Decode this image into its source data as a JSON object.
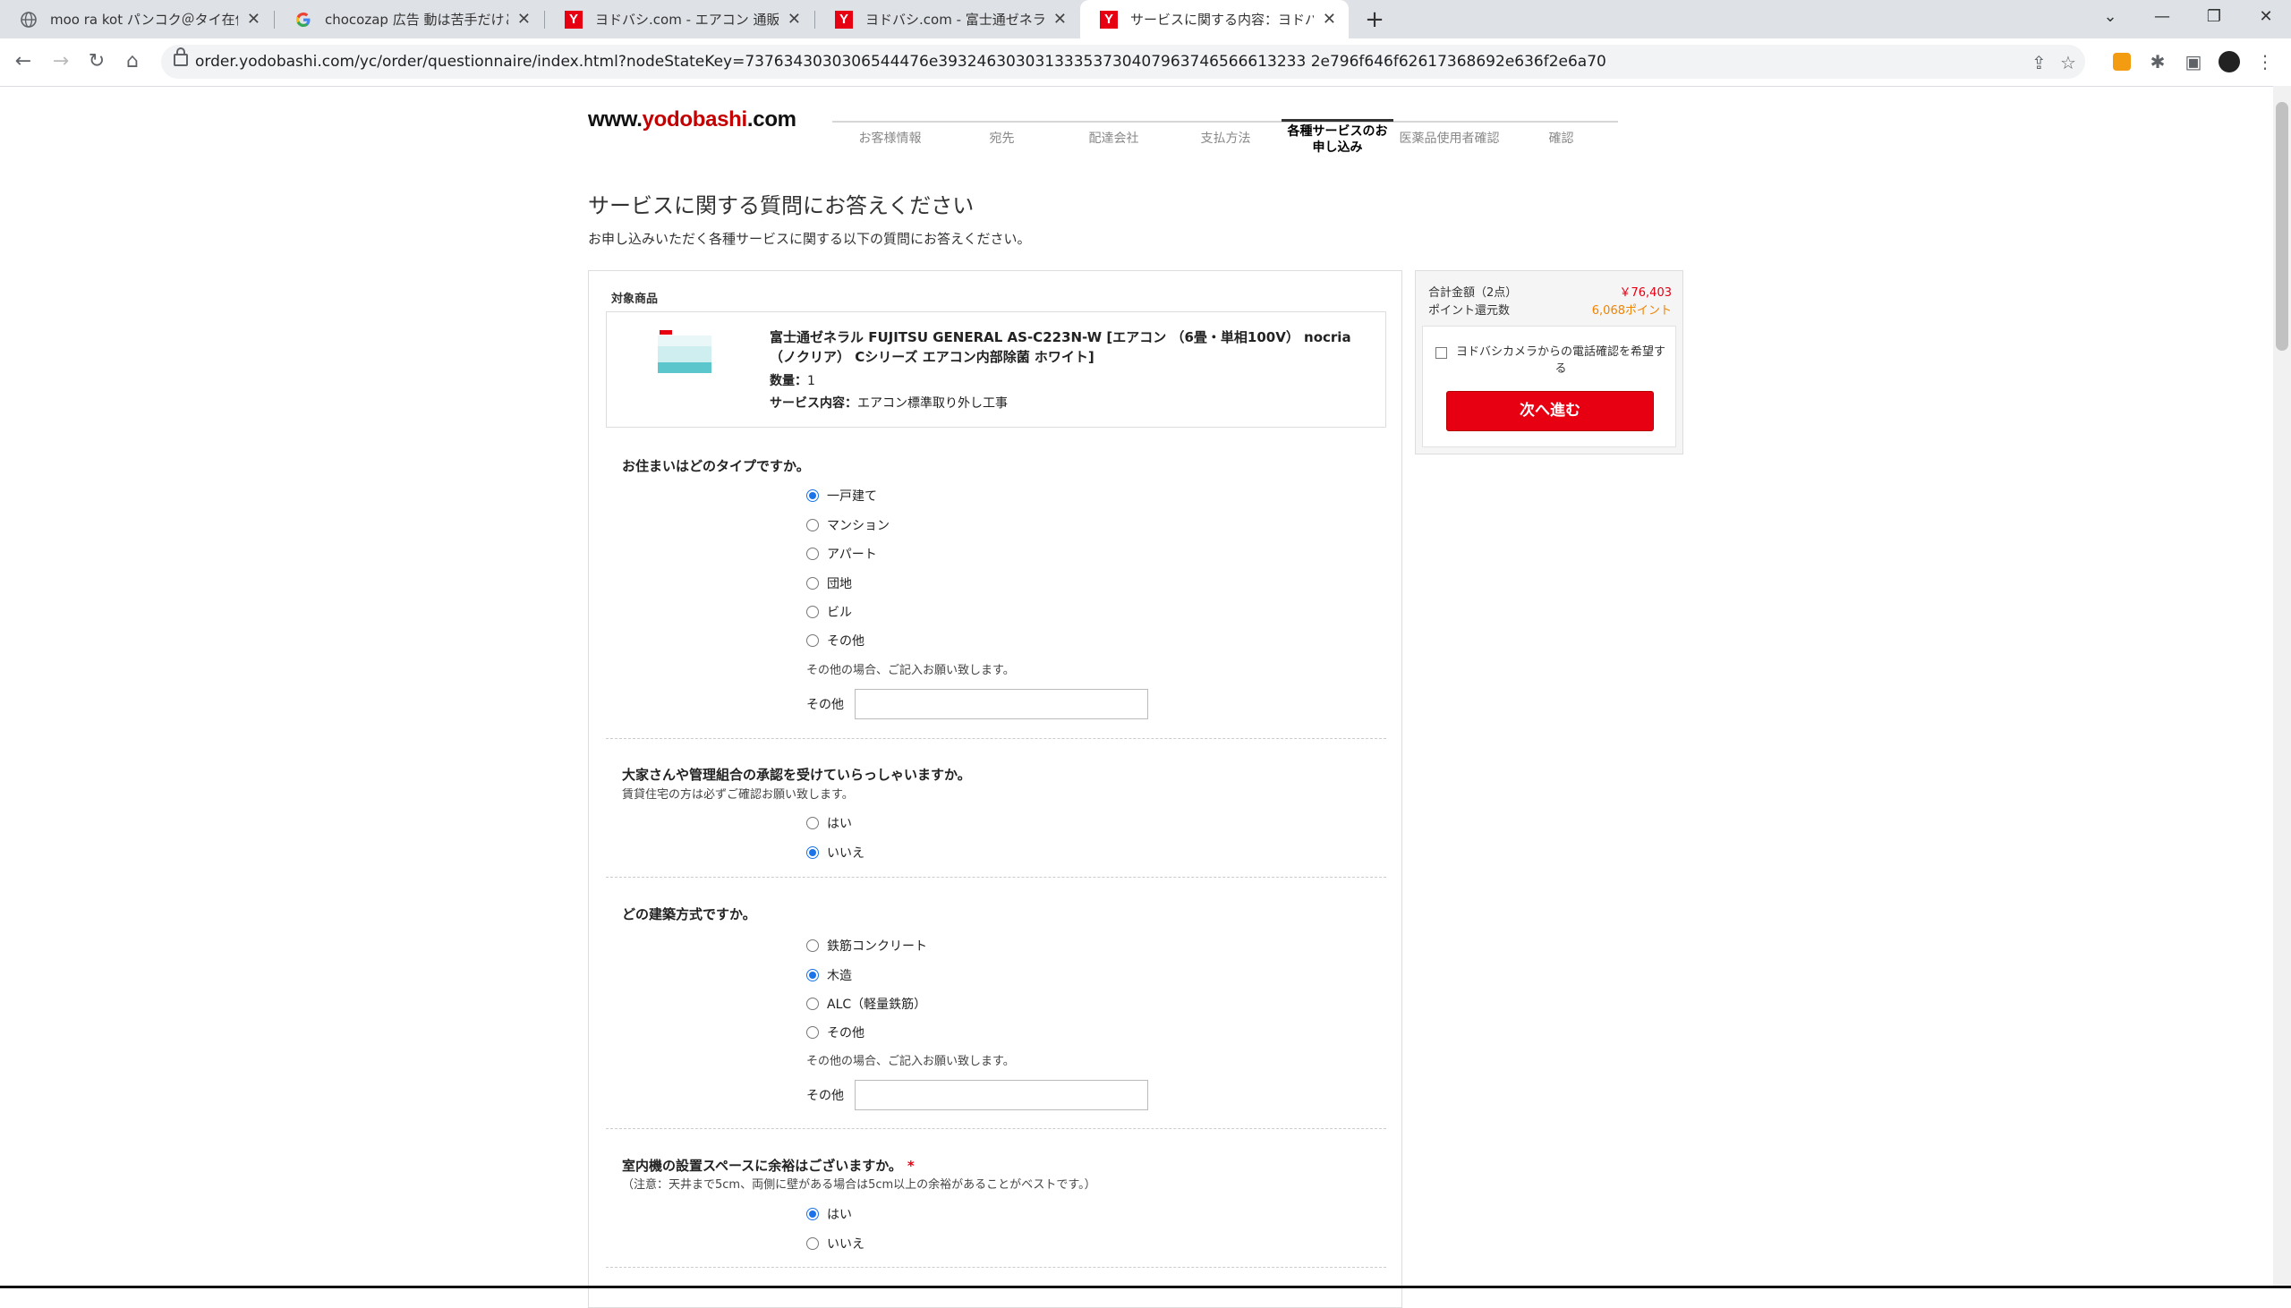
{
  "browser": {
    "tabs": [
      {
        "title": "moo ra kot パンコク＠タイ在住／美",
        "icon": "globe-icon"
      },
      {
        "title": "chocozap 広告 動は苦手だけどス",
        "icon": "google-icon"
      },
      {
        "title": "ヨドバシ.com - エアコン 通販【全品",
        "icon": "yodobashi-icon"
      },
      {
        "title": "ヨドバシ.com - 富士通ゼネラル FUJ",
        "icon": "yodobashi-icon"
      },
      {
        "title": "サービスに関する内容：ヨドバシ.ドッ",
        "icon": "yodobashi-icon"
      }
    ],
    "url": "order.yodobashi.com/yc/order/questionnaire/index.html?nodeStateKey=7376343030306544476e39324630303133353730407963746566613233 2e796f646f62617368692e636f2e6a70"
  },
  "header": {
    "logo_www": "www.",
    "logo_main": "yodobashi",
    "logo_tld": ".com",
    "steps": [
      "お客様情報",
      "宛先",
      "配達会社",
      "支払方法",
      "各種サービスのお申し込み",
      "医薬品使用者確認",
      "確認"
    ]
  },
  "page": {
    "title": "サービスに関する質問にお答えください",
    "lead": "お申し込みいただく各種サービスに関する以下の質問にお答えください。",
    "target_label": "対象商品"
  },
  "product": {
    "name": "富士通ゼネラル FUJITSU GENERAL AS-C223N-W [エアコン （6畳・単相100V） nocria（ノクリア） Cシリーズ エアコン内部除菌 ホワイト]",
    "qty_label": "数量：",
    "qty": "1",
    "service_label": "サービス内容：",
    "service": "エアコン標準取り外し工事"
  },
  "questions": {
    "q1": {
      "text": "お住まいはどのタイプですか。",
      "options": [
        "一戸建て",
        "マンション",
        "アパート",
        "団地",
        "ビル",
        "その他"
      ],
      "hint": "その他の場合、ご記入お願い致します。",
      "other_label": "その他"
    },
    "q2": {
      "text": "大家さんや管理組合の承認を受けていらっしゃいますか。",
      "note": "賃貸住宅の方は必ずご確認お願い致します。",
      "options": [
        "はい",
        "いいえ"
      ]
    },
    "q3": {
      "text": "どの建築方式ですか。",
      "options": [
        "鉄筋コンクリート",
        "木造",
        "ALC（軽量鉄筋）",
        "その他"
      ],
      "hint": "その他の場合、ご記入お願い致します。",
      "other_label": "その他"
    },
    "q4": {
      "text": "室内機の設置スペースに余裕はございますか。",
      "required_mark": "*",
      "note": "（注意：天井まで5cm、両側に壁がある場合は5cm以上の余裕があることがベストです。）",
      "options": [
        "はい",
        "いいえ"
      ]
    }
  },
  "sidebar": {
    "total_label": "合計金額（2点）",
    "total_value": "￥76,403",
    "points_label": "ポイント還元数",
    "points_value": "6,068ポイント",
    "phone_confirm_label": "ヨドバシカメラからの電話確認を希望する",
    "next_button": "次へ進む"
  },
  "colors": {
    "brand_red": "#e60012",
    "points_orange": "#f08300",
    "radio_blue": "#1a73e8"
  }
}
